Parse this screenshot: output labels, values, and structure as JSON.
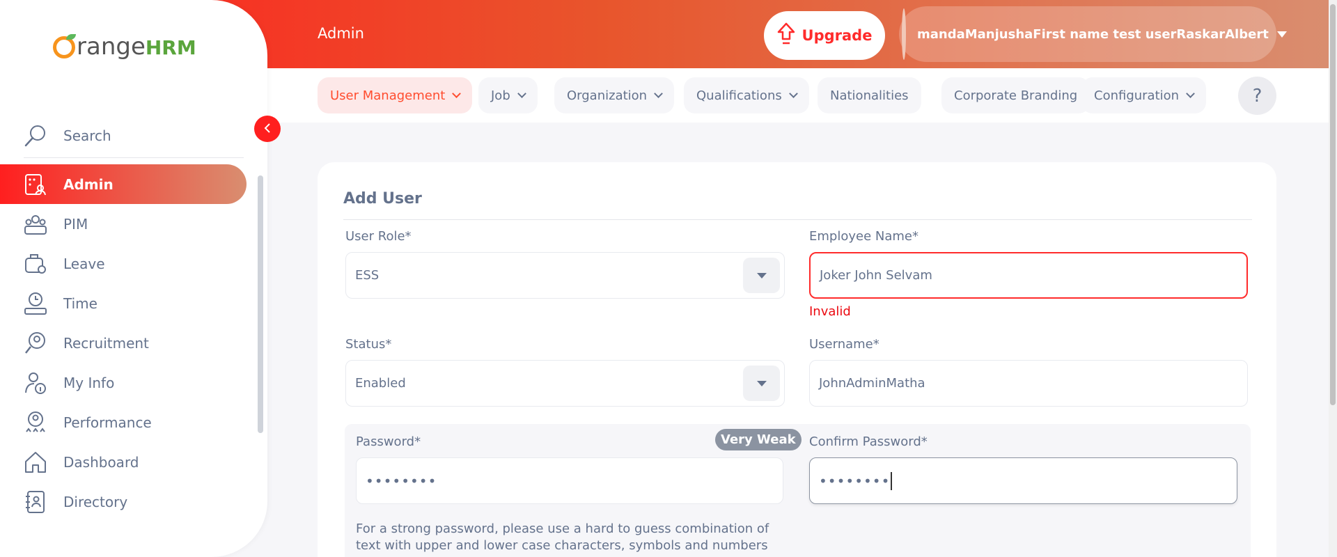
{
  "header": {
    "title": "Admin",
    "upgrade_label": "Upgrade",
    "user_name": "mandaManjushaFirst name test userRaskarAlbert"
  },
  "subnav": {
    "tabs": [
      {
        "label": "User Management"
      },
      {
        "label": "Job"
      },
      {
        "label": "Organization"
      },
      {
        "label": "Qualifications"
      },
      {
        "label": "Nationalities"
      },
      {
        "label": "Corporate Branding"
      },
      {
        "label": "Configuration"
      }
    ],
    "help_label": "?"
  },
  "sidebar": {
    "logo_text": "range",
    "logo_suffix": "HRM",
    "search_label": "Search",
    "items": [
      {
        "label": "Admin",
        "icon": "admin-icon"
      },
      {
        "label": "PIM",
        "icon": "pim-icon"
      },
      {
        "label": "Leave",
        "icon": "leave-icon"
      },
      {
        "label": "Time",
        "icon": "time-icon"
      },
      {
        "label": "Recruitment",
        "icon": "recruitment-icon"
      },
      {
        "label": "My Info",
        "icon": "my-info-icon"
      },
      {
        "label": "Performance",
        "icon": "performance-icon"
      },
      {
        "label": "Dashboard",
        "icon": "dashboard-icon"
      },
      {
        "label": "Directory",
        "icon": "directory-icon"
      }
    ]
  },
  "form": {
    "title": "Add User",
    "user_role": {
      "label": "User Role*",
      "value": "ESS"
    },
    "employee_name": {
      "label": "Employee Name*",
      "value": "Joker John Selvam",
      "error": "Invalid"
    },
    "status": {
      "label": "Status*",
      "value": "Enabled"
    },
    "username": {
      "label": "Username*",
      "value": "JohnAdminMatha"
    },
    "password": {
      "label": "Password*",
      "value": "••••••••",
      "strength": "Very Weak"
    },
    "confirm_password": {
      "label": "Confirm Password*",
      "value": "••••••••"
    },
    "hint": "For a strong password, please use a hard to guess combination of text with upper and lower case characters, symbols and numbers"
  },
  "colors": {
    "brand_red": "#ff1f1f",
    "brand_gradient_end": "#d98e70",
    "error": "#eb0910"
  }
}
